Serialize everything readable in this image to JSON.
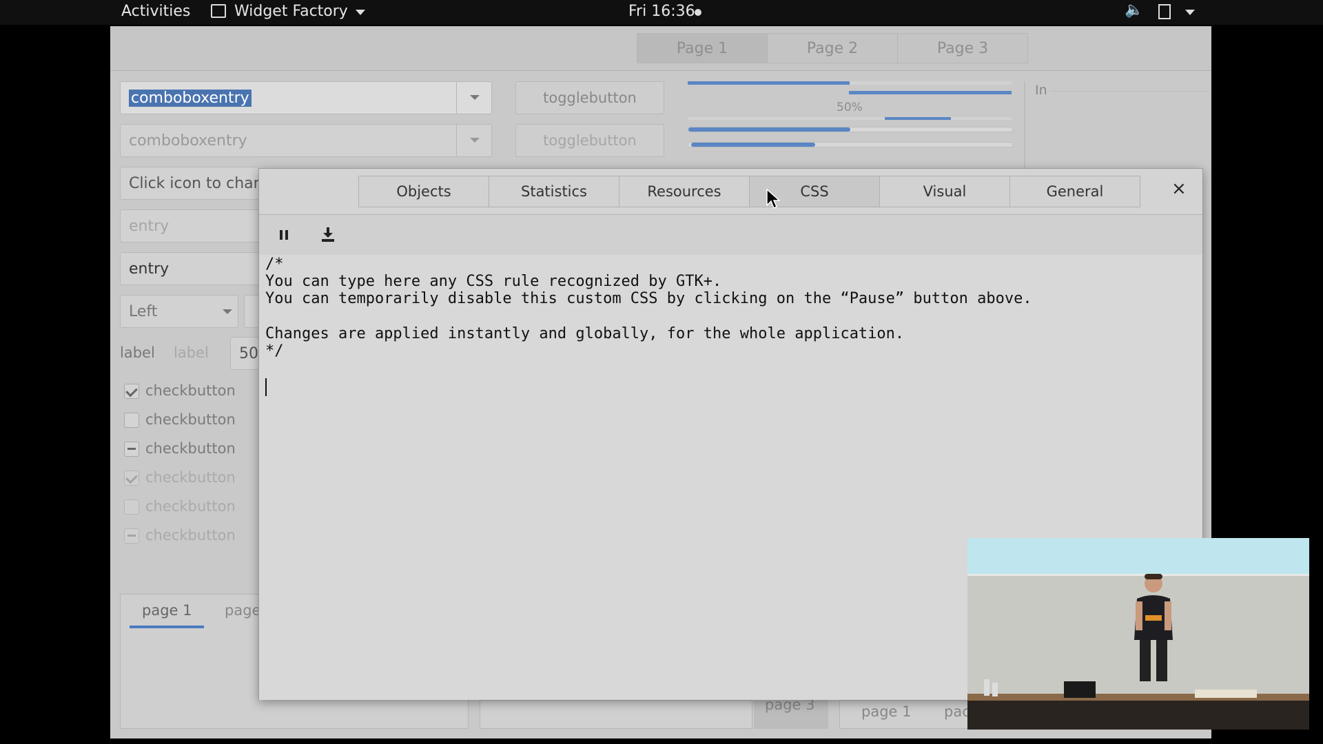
{
  "topbar": {
    "activities": "Activities",
    "app_name": "Widget Factory",
    "clock": "Fri 16:36"
  },
  "background_window": {
    "pages": [
      "Page 1",
      "Page 2",
      "Page 3"
    ],
    "combo1": "comboboxentry",
    "combo2": "comboboxentry",
    "toggle1": "togglebutton",
    "toggle2": "togglebutton",
    "icon_entry": "Click icon to chang",
    "entry_placeholder": "entry",
    "entry_value": "entry",
    "left_combo": "Left",
    "label1": "label",
    "label2": "label",
    "spin_value": "50",
    "progress_label": "50%",
    "checkbuttons": [
      "checkbutton",
      "checkbutton",
      "checkbutton",
      "checkbutton",
      "checkbutton",
      "checkbutton"
    ],
    "right_frame_label": "In",
    "notebook_tab1": "page 1",
    "notebook_tab2": "page",
    "notebook2_tab3": "page 3",
    "notebook3_tab1": "page 1",
    "notebook3_tab2": "pac"
  },
  "inspector": {
    "tabs": [
      "Objects",
      "Statistics",
      "Resources",
      "CSS",
      "Visual",
      "General"
    ],
    "active_tab": "CSS",
    "close": "×",
    "editor_lines": [
      "/*",
      "You can type here any CSS rule recognized by GTK+.",
      "You can temporarily disable this custom CSS by clicking on the “Pause” button above.",
      "",
      "Changes are applied instantly and globally, for the whole application.",
      "*/"
    ]
  },
  "progress": {
    "bar1": 0.5,
    "bar2": 0.5
  }
}
